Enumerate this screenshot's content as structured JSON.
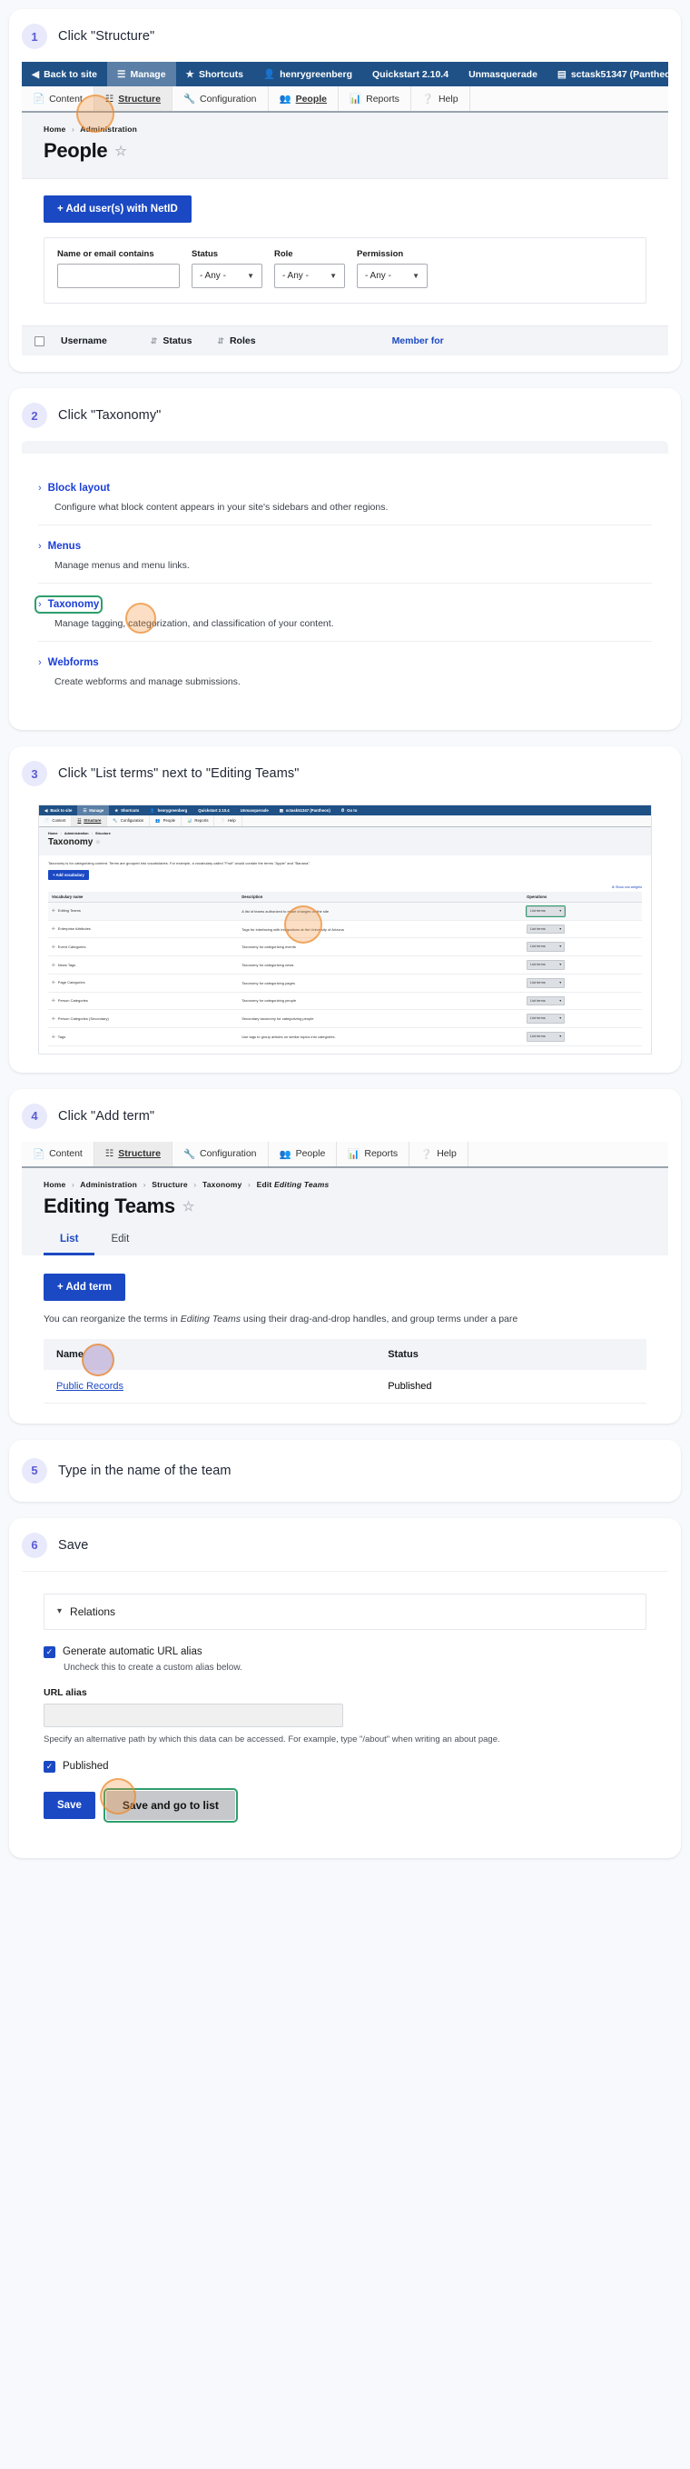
{
  "steps": [
    {
      "num": "1",
      "title": "Click \"Structure\""
    },
    {
      "num": "2",
      "title": "Click \"Taxonomy\""
    },
    {
      "num": "3",
      "title": "Click \"List terms\" next to \"Editing Teams\""
    },
    {
      "num": "4",
      "title": "Click \"Add term\""
    },
    {
      "num": "5",
      "title": "Type in the name of the team"
    },
    {
      "num": "6",
      "title": "Save"
    }
  ],
  "toolbar": {
    "items": [
      {
        "label": "Back to site",
        "icon": "back-arrow-icon"
      },
      {
        "label": "Manage",
        "icon": "hamburger-icon"
      },
      {
        "label": "Shortcuts",
        "icon": "star-icon"
      },
      {
        "label": "henrygreenberg",
        "icon": "user-icon"
      },
      {
        "label": "Quickstart 2.10.4",
        "icon": ""
      },
      {
        "label": "Unmasquerade",
        "icon": ""
      },
      {
        "label": "sctask51347 (Pantheon)",
        "icon": "server-icon"
      },
      {
        "label": "Go to",
        "icon": "clock-icon"
      }
    ],
    "tabs": [
      {
        "label": "Content",
        "icon": "document-icon"
      },
      {
        "label": "Structure",
        "icon": "sitemap-icon"
      },
      {
        "label": "Configuration",
        "icon": "wrench-icon"
      },
      {
        "label": "People",
        "icon": "people-icon"
      },
      {
        "label": "Reports",
        "icon": "chart-icon"
      },
      {
        "label": "Help",
        "icon": "question-icon"
      }
    ]
  },
  "people_page": {
    "breadcrumbs": [
      "Home",
      "Administration"
    ],
    "title": "People",
    "add_button": "+ Add user(s) with NetID",
    "filters": [
      {
        "label": "Name or email contains",
        "type": "text",
        "value": ""
      },
      {
        "label": "Status",
        "type": "select",
        "value": "- Any -"
      },
      {
        "label": "Role",
        "type": "select",
        "value": "- Any -"
      },
      {
        "label": "Permission",
        "type": "select",
        "value": "- Any -"
      }
    ],
    "table_headers": [
      "Username",
      "Status",
      "Roles",
      "Member for"
    ]
  },
  "structure_index": {
    "items": [
      {
        "label": "Block layout",
        "desc": "Configure what block content appears in your site's sidebars and other regions."
      },
      {
        "label": "Menus",
        "desc": "Manage menus and menu links."
      },
      {
        "label": "Taxonomy",
        "desc": "Manage tagging, categorization, and classification of your content."
      },
      {
        "label": "Webforms",
        "desc": "Create webforms and manage submissions."
      }
    ]
  },
  "taxonomy_page": {
    "breadcrumbs": [
      "Home",
      "Administration",
      "Structure"
    ],
    "title": "Taxonomy",
    "intro": "Taxonomy is for categorizing content. Terms are grouped into vocabularies. For example, a vocabulary called \"Fruit\" would contain the terms \"Apple\" and \"Banana\".",
    "add_button": "+ Add vocabulary",
    "show_weights": "Show row weights",
    "headers": [
      "Vocabulary name",
      "Description",
      "Operations"
    ],
    "op_label": "List terms",
    "rows": [
      {
        "name": "Editing Teams",
        "desc": "A list of teams authorized to make changes on the site"
      },
      {
        "name": "Enterprise Attributes",
        "desc": "Tags for interfacing with integrations at the University of Arizona"
      },
      {
        "name": "Event Categories",
        "desc": "Taxonomy for categorizing events"
      },
      {
        "name": "News Tags",
        "desc": "Taxonomy for categorizing news"
      },
      {
        "name": "Page Categories",
        "desc": "Taxonomy for categorizing pages"
      },
      {
        "name": "Person Categories",
        "desc": "Taxonomy for categorizing people"
      },
      {
        "name": "Person Categories (Secondary)",
        "desc": "Secondary taxonomy for categorizing people"
      },
      {
        "name": "Tags",
        "desc": "Use tags to group articles on similar topics into categories."
      }
    ]
  },
  "editing_teams_page": {
    "breadcrumbs": [
      "Home",
      "Administration",
      "Structure",
      "Taxonomy"
    ],
    "breadcrumb_last_prefix": "Edit ",
    "breadcrumb_last_em": "Editing Teams",
    "title": "Editing Teams",
    "tabs": [
      "List",
      "Edit"
    ],
    "add_button": "+ Add term",
    "note_prefix": "You can reorganize the terms in ",
    "note_em": "Editing Teams",
    "note_suffix": " using their drag-and-drop handles, and group terms under a pare",
    "headers": [
      "Name",
      "Status"
    ],
    "rows": [
      {
        "name": "Public Records",
        "status": "Published"
      }
    ]
  },
  "save_form": {
    "relations_label": "Relations",
    "auto_alias_label": "Generate automatic URL alias",
    "auto_alias_note": "Uncheck this to create a custom alias below.",
    "url_alias_label": "URL alias",
    "url_alias_value": "",
    "url_alias_desc": "Specify an alternative path by which this data can be accessed. For example, type \"/about\" when writing an about page.",
    "published_label": "Published",
    "save_button": "Save",
    "save_go_list_button": "Save and go to list"
  },
  "colors": {
    "toolbar_blue": "#1f5186",
    "primary_blue": "#1b49c4",
    "link_blue": "#1b3fd8",
    "highlight_ring": "#ed892a",
    "highlight_box": "#2f9e6e",
    "step_num": "#5b5bd6"
  }
}
